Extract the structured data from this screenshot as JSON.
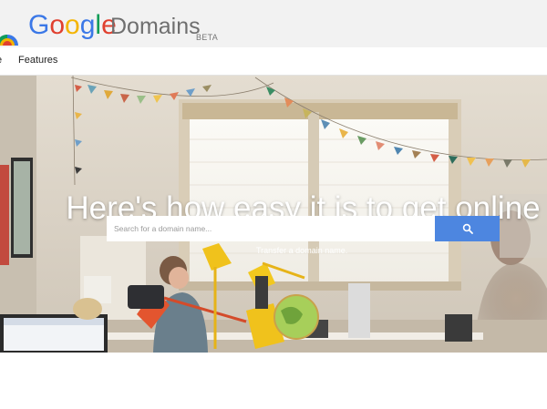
{
  "header": {
    "logo_icon": "google-domains-arc-icon",
    "brand_letters": [
      {
        "ch": "G",
        "color": "#3b78e7"
      },
      {
        "ch": "o",
        "color": "#e0402f"
      },
      {
        "ch": "o",
        "color": "#f4b400"
      },
      {
        "ch": "g",
        "color": "#3b78e7"
      },
      {
        "ch": "l",
        "color": "#0f9d58"
      },
      {
        "ch": "e",
        "color": "#e0402f"
      }
    ],
    "product": "Domains",
    "beta": "BETA"
  },
  "nav": {
    "home_label": "e",
    "features_label": "Features"
  },
  "hero": {
    "headline": "Here's how easy it is to get online",
    "search": {
      "placeholder": "Search for a domain name...",
      "value": "",
      "button_icon": "search-icon",
      "button_color": "#4d86e0"
    },
    "transfer_link": "Transfer a domain name."
  }
}
